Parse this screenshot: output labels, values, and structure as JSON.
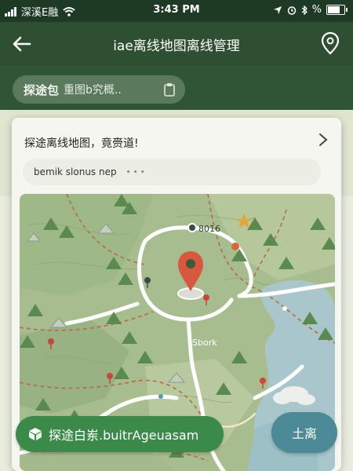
{
  "status_bar": {
    "carrier": "深溪E融",
    "time": "3:43 PM",
    "battery_text": "%"
  },
  "nav": {
    "title": "iae离线地图离线管理",
    "back_icon": "back-arrow-icon",
    "location_icon": "map-pin-icon"
  },
  "search": {
    "label": "探途包",
    "text": "重图b究概.."
  },
  "card": {
    "header": "探途离线地图，竟赍道!",
    "subtitle": "bemik slonus nep",
    "subtitle_dots": "• • •"
  },
  "map": {
    "label_top": "8016",
    "label_mid": "Sbork"
  },
  "actions": {
    "explore_label": "探途白岽.buitrAgeuasam",
    "leave_label": "土离"
  },
  "colors": {
    "nav_bg": "#2f4f33",
    "explore_btn": "#3c8a4a",
    "leave_btn": "#4b8a96",
    "pin": "#d9573e"
  }
}
